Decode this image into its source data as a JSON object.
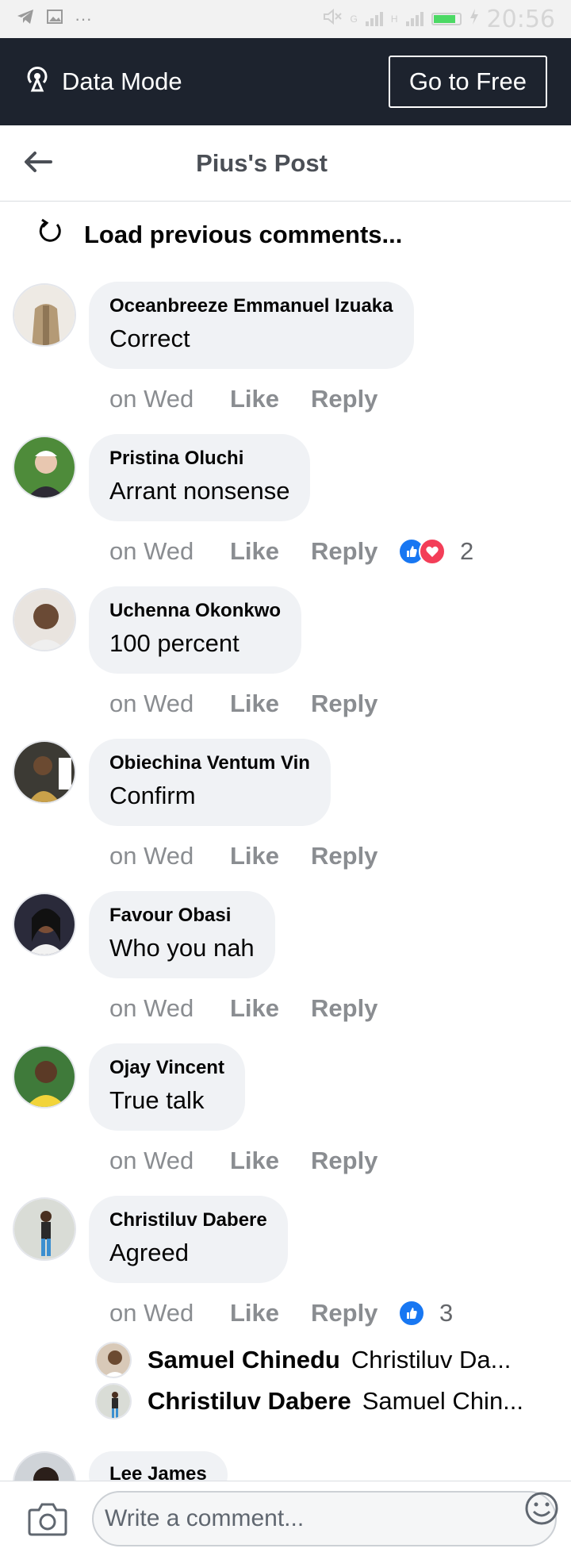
{
  "statusbar": {
    "time": "20:56",
    "net_label_1": "G",
    "net_label_2": "H",
    "more": "···"
  },
  "databar": {
    "mode_label": "Data Mode",
    "go_label": "Go to Free"
  },
  "header": {
    "title": "Pius's Post"
  },
  "load_previous": "Load previous comments...",
  "actions": {
    "time": "on Wed",
    "like": "Like",
    "reply": "Reply"
  },
  "comments": [
    {
      "author": "Oceanbreeze Emmanuel Izuaka",
      "text": "Correct"
    },
    {
      "author": "Pristina Oluchi",
      "text": "Arrant nonsense",
      "reactions": [
        "like",
        "love"
      ],
      "reaction_count": "2"
    },
    {
      "author": "Uchenna Okonkwo",
      "text": "100 percent"
    },
    {
      "author": "Obiechina Ventum Vin",
      "text": "Confirm"
    },
    {
      "author": "Favour Obasi",
      "text": "Who you nah"
    },
    {
      "author": "Ojay Vincent",
      "text": "True talk"
    },
    {
      "author": "Christiluv Dabere",
      "text": "Agreed",
      "reactions": [
        "like"
      ],
      "reaction_count": "3",
      "replies": [
        {
          "author": "Samuel Chinedu",
          "text": "Christiluv Da..."
        },
        {
          "author": "Christiluv Dabere",
          "text": "Samuel Chin..."
        }
      ]
    },
    {
      "author": "Lee James"
    }
  ],
  "composer": {
    "placeholder": "Write a comment..."
  },
  "colors": {
    "banner": "#1d232e",
    "bubble": "#f0f2f5",
    "like": "#1877f2",
    "love": "#f33e58",
    "meta": "#8a8d91"
  }
}
